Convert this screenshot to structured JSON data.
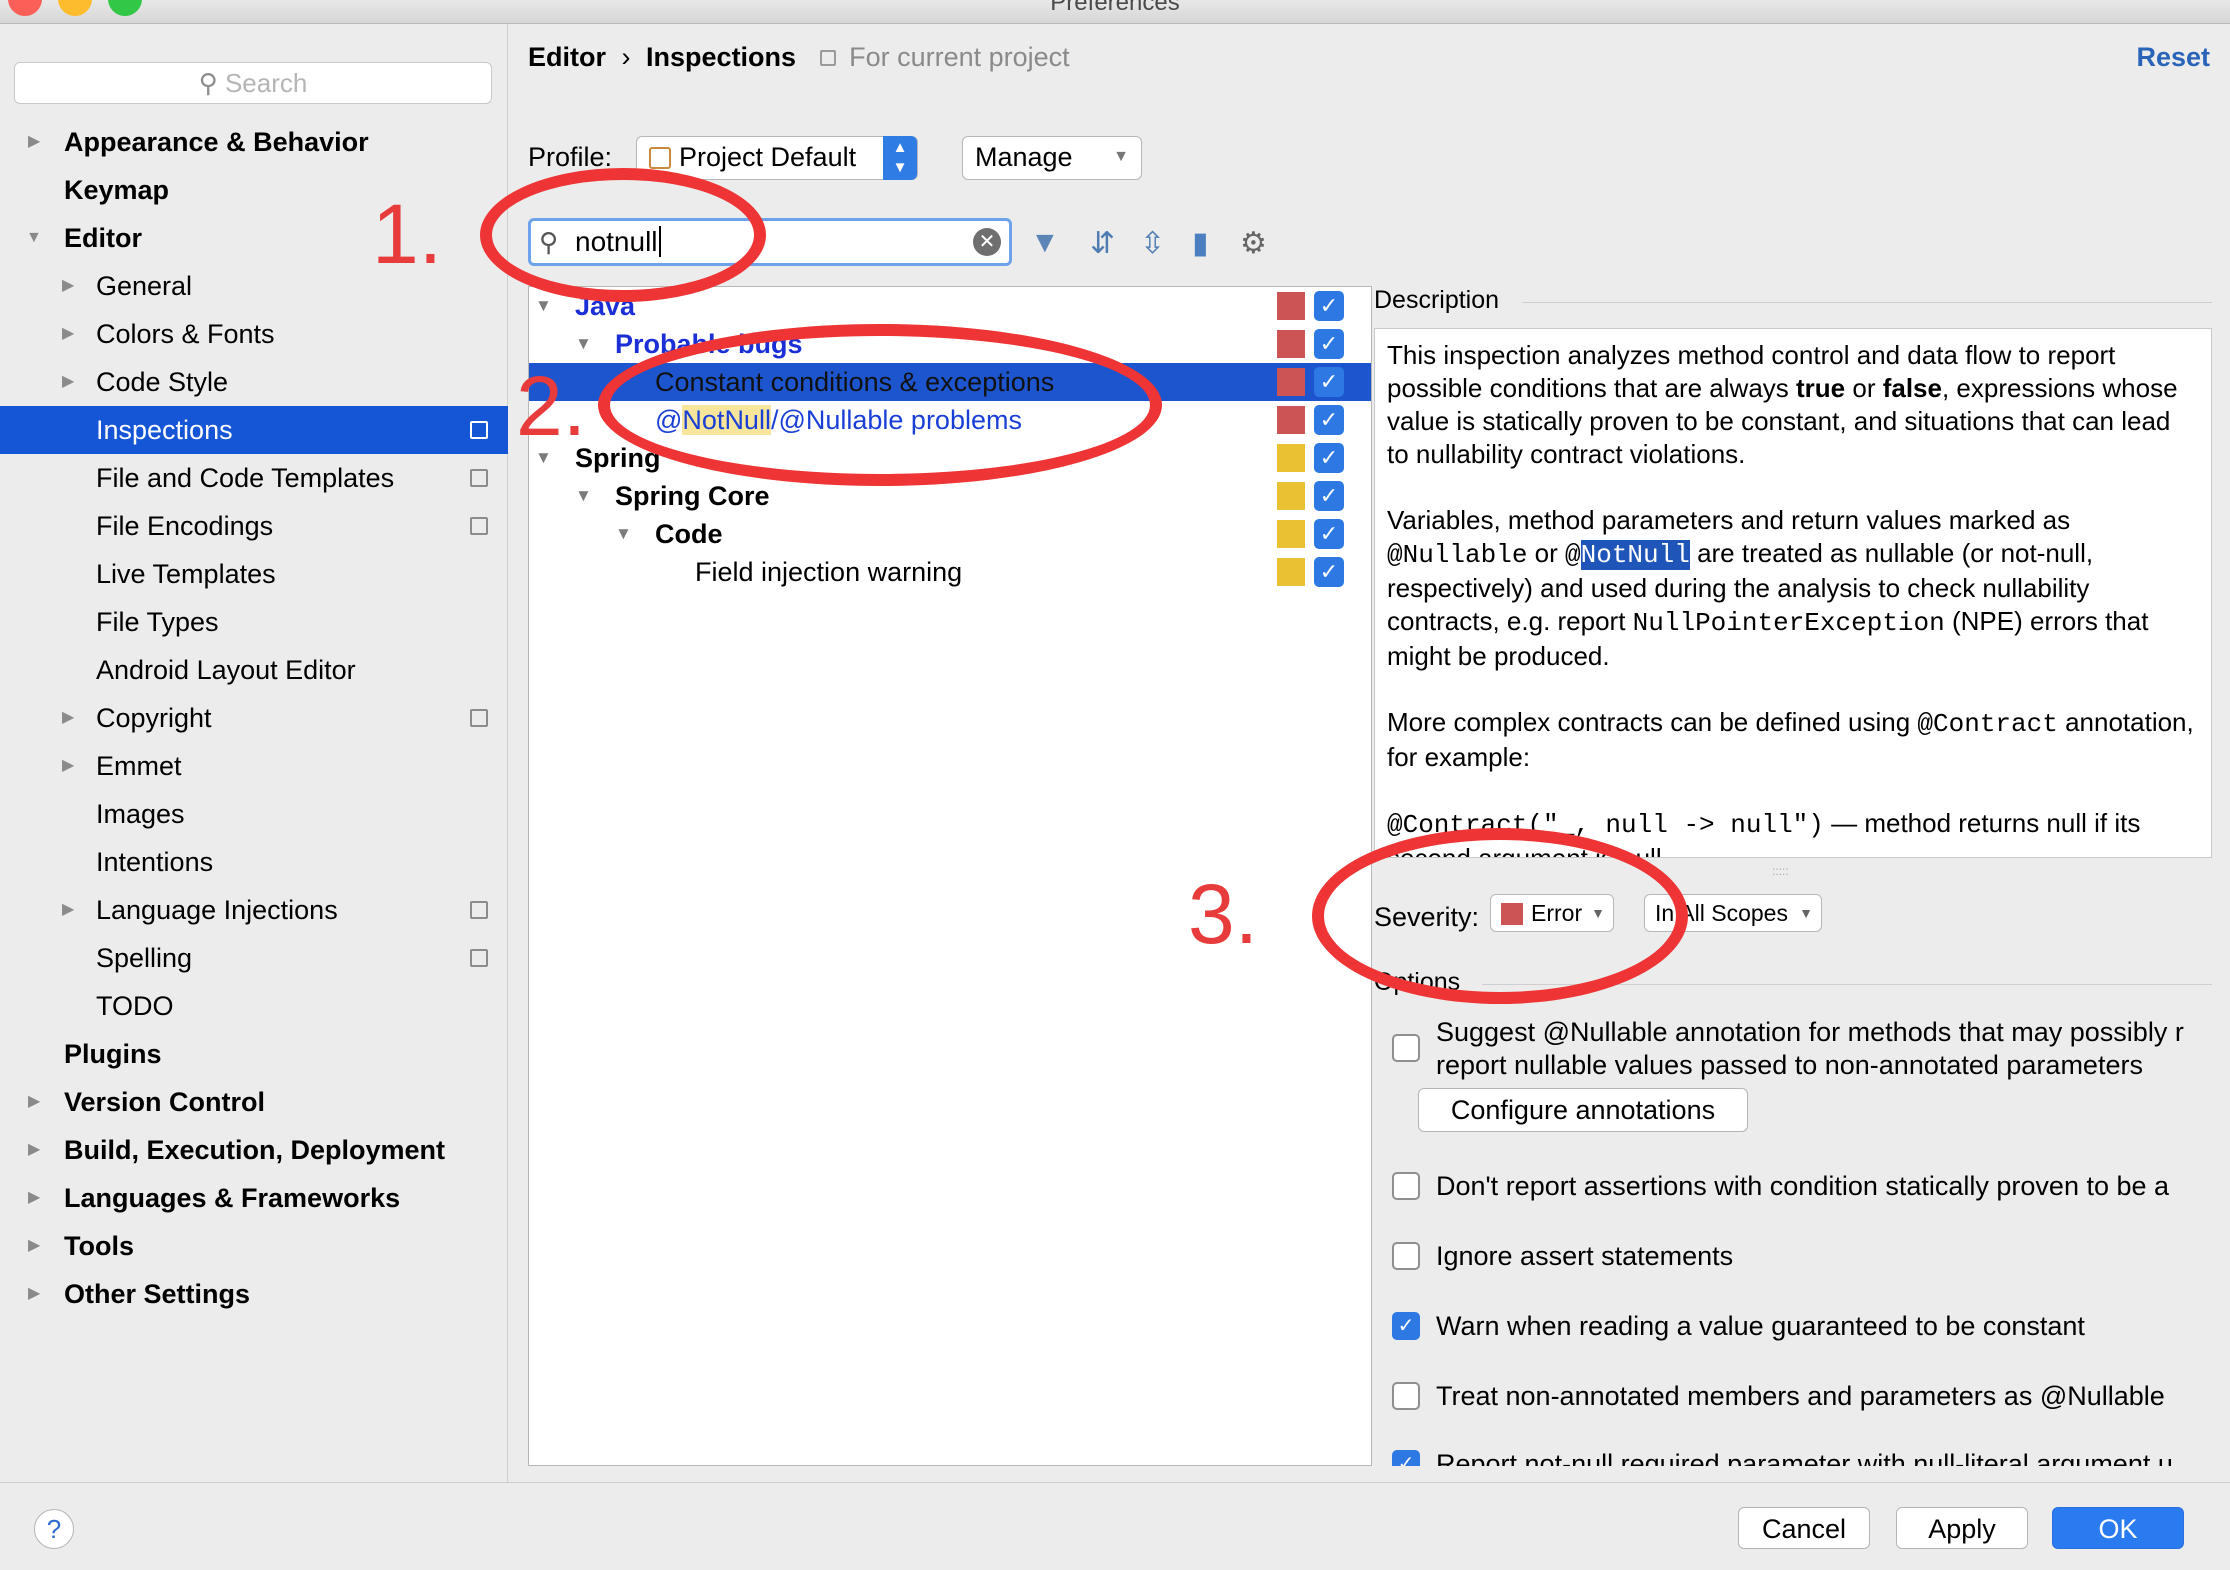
{
  "window": {
    "title": "Preferences"
  },
  "sidebar": {
    "search_placeholder": "Search",
    "items": [
      {
        "label": "Appearance & Behavior"
      },
      {
        "label": "Keymap"
      },
      {
        "label": "Editor"
      },
      {
        "label": "General"
      },
      {
        "label": "Colors & Fonts"
      },
      {
        "label": "Code Style"
      },
      {
        "label": "Inspections"
      },
      {
        "label": "File and Code Templates"
      },
      {
        "label": "File Encodings"
      },
      {
        "label": "Live Templates"
      },
      {
        "label": "File Types"
      },
      {
        "label": "Android Layout Editor"
      },
      {
        "label": "Copyright"
      },
      {
        "label": "Emmet"
      },
      {
        "label": "Images"
      },
      {
        "label": "Intentions"
      },
      {
        "label": "Language Injections"
      },
      {
        "label": "Spelling"
      },
      {
        "label": "TODO"
      },
      {
        "label": "Plugins"
      },
      {
        "label": "Version Control"
      },
      {
        "label": "Build, Execution, Deployment"
      },
      {
        "label": "Languages & Frameworks"
      },
      {
        "label": "Tools"
      },
      {
        "label": "Other Settings"
      }
    ]
  },
  "header": {
    "crumb_editor": "Editor",
    "crumb_sep": "›",
    "crumb_inspections": "Inspections",
    "scope_note": "For current project",
    "reset": "Reset"
  },
  "profile": {
    "label": "Profile:",
    "value": "Project Default",
    "manage": "Manage"
  },
  "filter": {
    "value": "notnull"
  },
  "tree": {
    "java": "Java",
    "probable_bugs": "Probable bugs",
    "constant_conditions": "Constant conditions & exceptions",
    "notnull_at": "@",
    "notnull_hl": "NotNull",
    "notnull_rest": "/@Nullable problems",
    "spring": "Spring",
    "spring_core": "Spring Core",
    "code": "Code",
    "field_injection": "Field injection warning",
    "check": "✓"
  },
  "description": {
    "label": "Description",
    "p1a": "This inspection analyzes method control and data flow to report possible conditions that are always ",
    "p1b": "true",
    "p1c": " or ",
    "p1d": "false",
    "p1e": ", expressions whose value is statically proven to be constant, and situations that can lead to nullability contract violations.",
    "p2a": "Variables, method parameters and return values marked as ",
    "p2b": "@Nullable",
    "p2c": " or ",
    "p2d": "@",
    "p2e": "NotNull",
    "p2f": " are treated as nullable (or not-null, respectively) and used during the analysis to check nullability contracts, e.g. report ",
    "p2g": "NullPointerException",
    "p2h": " (NPE) errors that might be produced.",
    "p3a": "More complex contracts can be defined using ",
    "p3b": "@Contract",
    "p3c": " annotation, for example:",
    "p4a": "@Contract(\"_, null -> null\")",
    "p4b": " — method returns null if its second argument is null"
  },
  "severity": {
    "label": "Severity:",
    "value": "Error",
    "scope": "In All Scopes"
  },
  "options": {
    "label": "Options",
    "items": [
      {
        "text": "Suggest @Nullable annotation for methods that may possibly r",
        "text2": "report nullable values passed to non-annotated parameters"
      },
      {
        "text": "Don't report assertions with condition statically proven to be a"
      },
      {
        "text": "Ignore assert statements"
      },
      {
        "text": "Warn when reading a value guaranteed to be constant"
      },
      {
        "text": "Treat non-annotated members and parameters as @Nullable"
      },
      {
        "text": "Report not-null required parameter with null-literal argument u"
      }
    ],
    "configure": "Configure annotations"
  },
  "footer": {
    "help": "?",
    "cancel": "Cancel",
    "apply": "Apply",
    "ok": "OK"
  },
  "annotations": {
    "one": "1.",
    "two": "2.",
    "three": "3."
  },
  "colors": {
    "accent": "#1556d6",
    "error": "#cd5454",
    "warning": "#e9c132",
    "annotation": "#ee3434"
  }
}
